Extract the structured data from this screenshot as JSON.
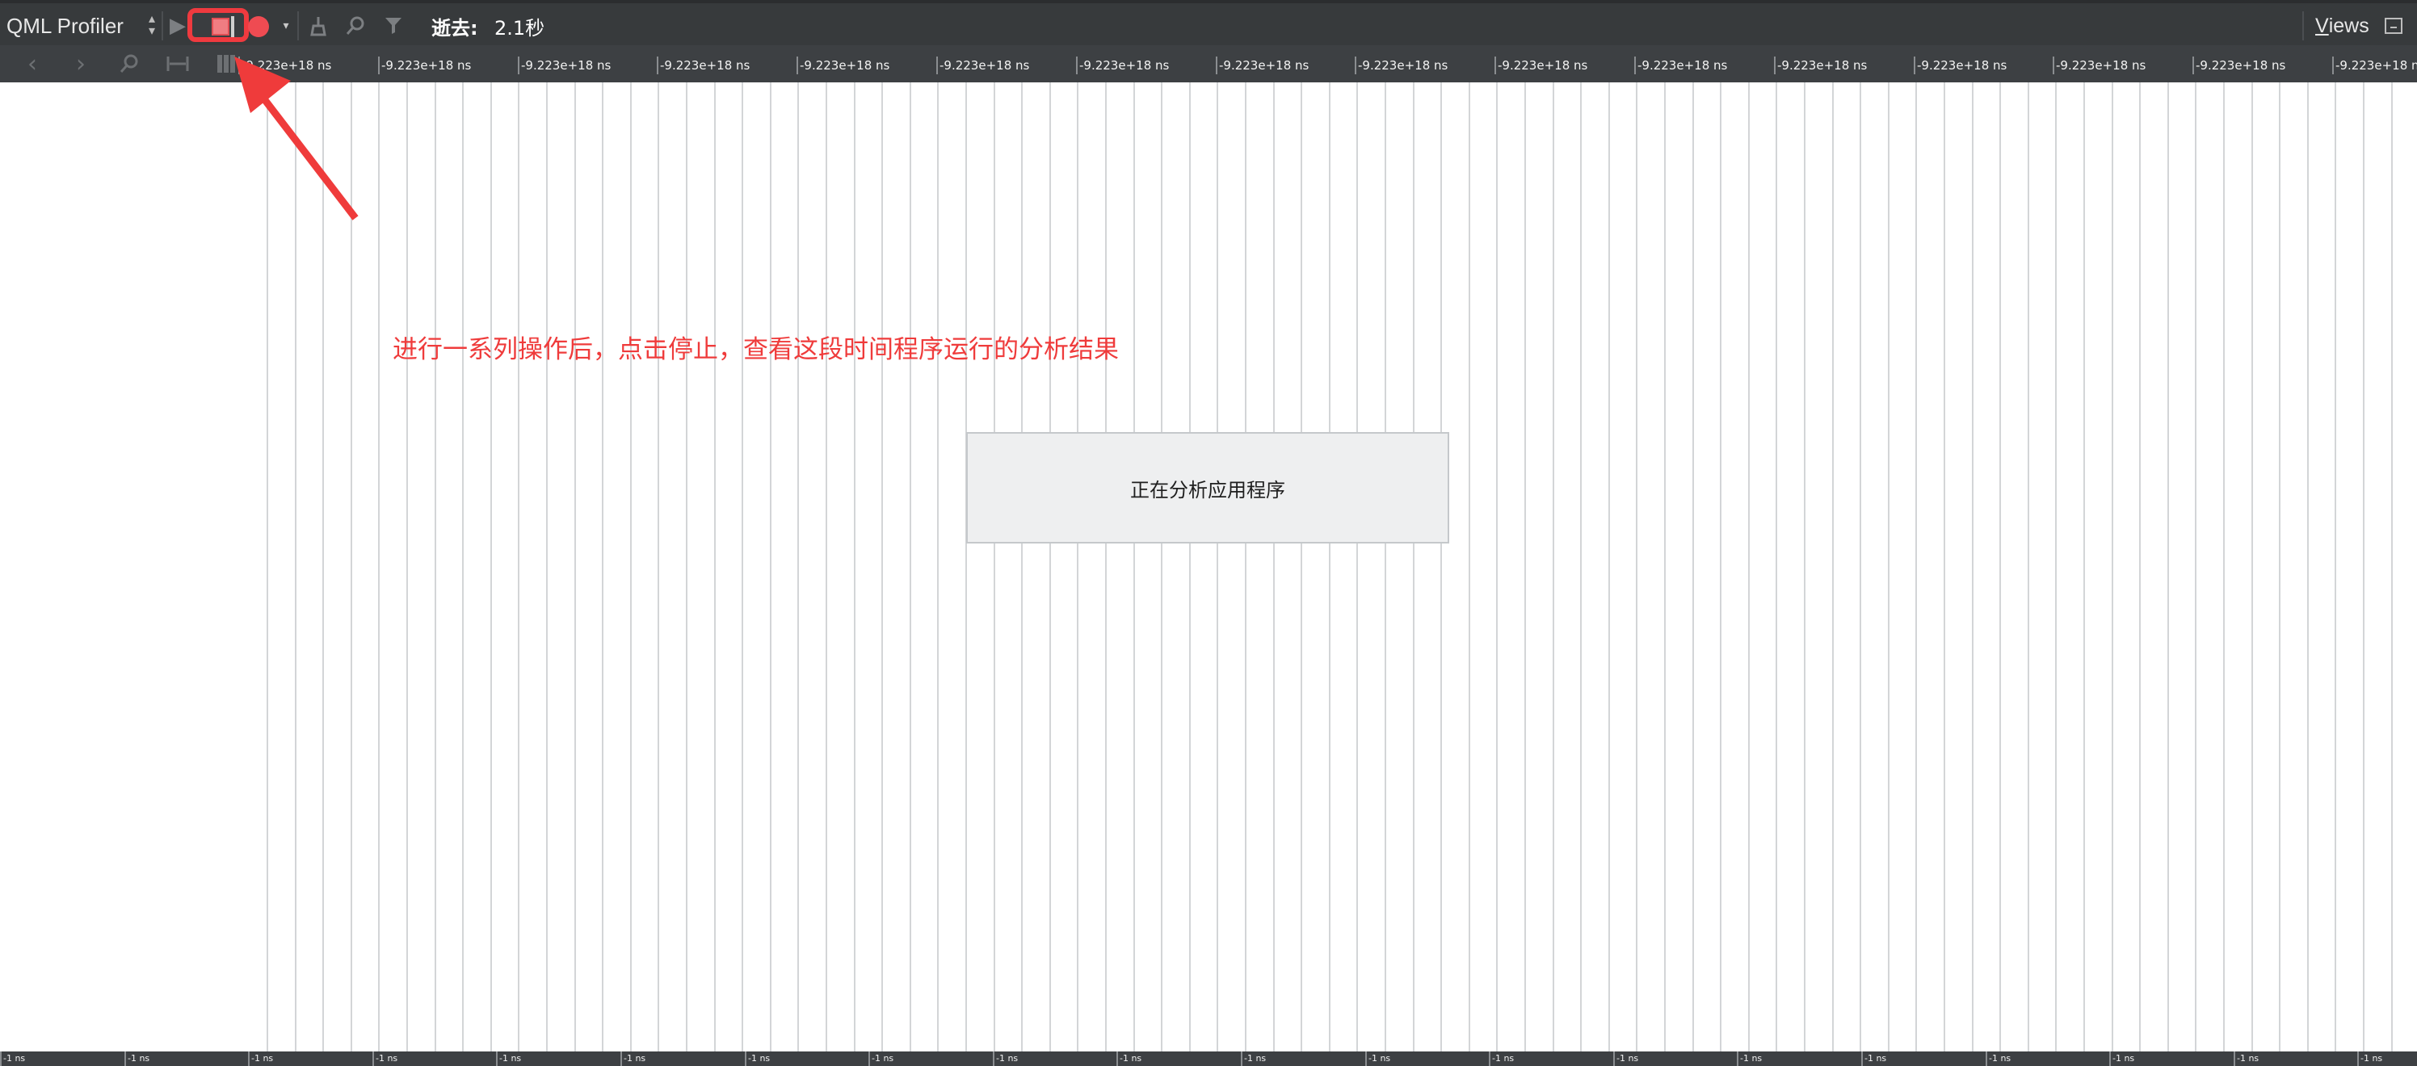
{
  "toolbar": {
    "mode_select": "QML Profiler",
    "elapsed_label": "逝去:",
    "elapsed_value": "2.1秒",
    "views_label": "Views",
    "views_underline": "V",
    "views_rest": "iews"
  },
  "timeline": {
    "top_tick_label": "-9.223e+18 ns",
    "bottom_tick_label": "-1 ns"
  },
  "annotation": "进行一系列操作后，点击停止，查看这段时间程序运行的分析结果",
  "status_box": "正在分析应用程序",
  "colors": {
    "toolbar_bg": "#373a3c",
    "highlight_red": "#ef3a3f",
    "annotation_red": "#ef3b3b",
    "record_red": "#ef4b52"
  },
  "icons": [
    "up-down-arrows-icon",
    "play-icon",
    "stop-icon",
    "record-icon",
    "dropdown-arrow-icon",
    "broom-icon",
    "search-icon",
    "filter-icon",
    "back-icon",
    "forward-icon",
    "zoom-icon",
    "range-icon",
    "grid-icon",
    "views-collapse-icon"
  ]
}
